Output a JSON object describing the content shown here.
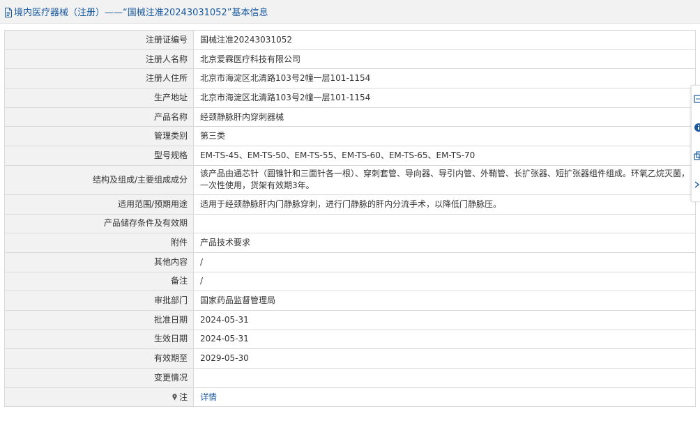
{
  "header": {
    "title": "境内医疗器械（注册）——“国械注准20243031052”基本信息"
  },
  "rows": [
    {
      "label": "注册证编号",
      "value": "国械注准20243031052"
    },
    {
      "label": "注册人名称",
      "value": "北京爱霖医疗科技有限公司"
    },
    {
      "label": "注册人住所",
      "value": "北京市海淀区北清路103号2幢一层101-1154"
    },
    {
      "label": "生产地址",
      "value": "北京市海淀区北清路103号2幢一层101-1154"
    },
    {
      "label": "产品名称",
      "value": "经颈静脉肝内穿刺器械"
    },
    {
      "label": "管理类别",
      "value": "第三类"
    },
    {
      "label": "型号规格",
      "value": "EM-TS-45、EM-TS-50、EM-TS-55、EM-TS-60、EM-TS-65、EM-TS-70"
    },
    {
      "label": "结构及组成/主要组成成分",
      "value": "该产品由通芯针（圆锥针和三面针各一根）、穿刺套管、导向器、导引内管、外鞘管、长扩张器、短扩张器组件组成。环氧乙烷灭菌，一次性使用，货架有效期3年。"
    },
    {
      "label": "适用范围/预期用途",
      "value": "适用于经颈静脉肝内门静脉穿刺，进行门静脉的肝内分流手术，以降低门静脉压。"
    },
    {
      "label": "产品储存条件及有效期",
      "value": ""
    },
    {
      "label": "附件",
      "value": "产品技术要求"
    },
    {
      "label": "其他内容",
      "value": "/"
    },
    {
      "label": "备注",
      "value": "/"
    },
    {
      "label": "审批部门",
      "value": "国家药品监督管理局"
    },
    {
      "label": "批准日期",
      "value": "2024-05-31"
    },
    {
      "label": "生效日期",
      "value": "2024-05-31"
    },
    {
      "label": "有效期至",
      "value": "2029-05-30"
    },
    {
      "label": "变更情况",
      "value": ""
    },
    {
      "label": "注",
      "value": "详情"
    }
  ],
  "icons": {
    "header": "document-icon",
    "note": "pin-icon",
    "toolbar": [
      "screenshot-icon",
      "help-icon",
      "copy-icon",
      "collapse-icon"
    ]
  },
  "colors": {
    "link": "#1a5aa0",
    "label_bg": "#f2f2f2",
    "border": "#d9d9d9",
    "header_bg": "#f2f2f2"
  }
}
